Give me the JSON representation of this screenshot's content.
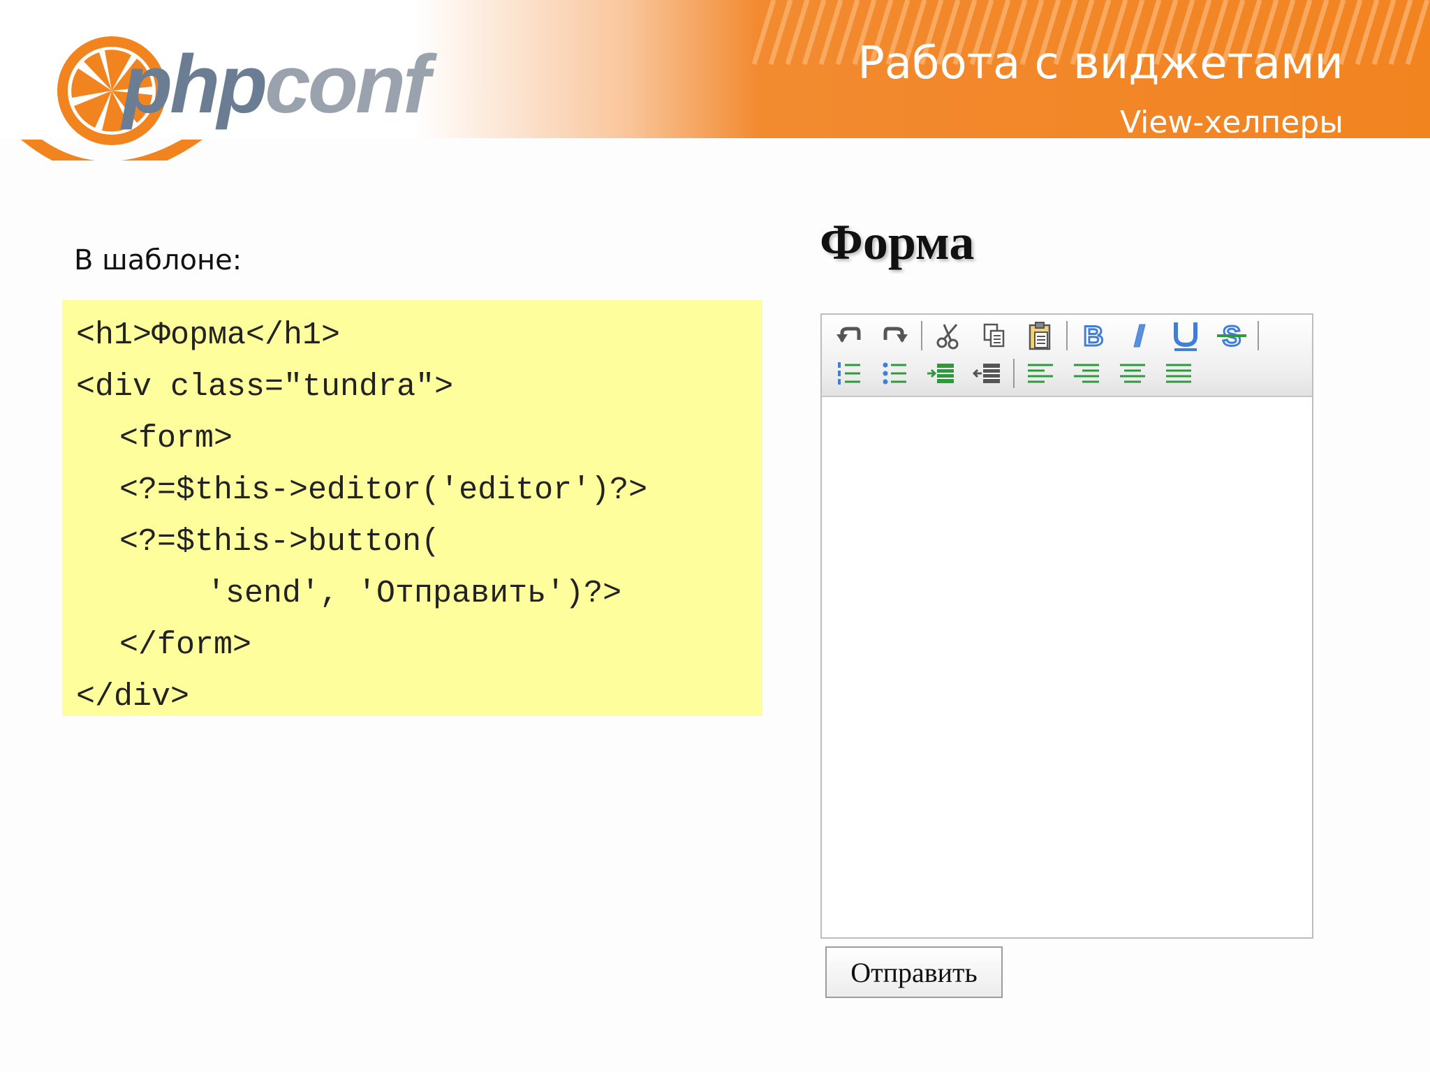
{
  "slide": {
    "title": "Работа с виджетами",
    "subtitle": "View-хелперы"
  },
  "logo": {
    "part1": "php",
    "part2": "conf"
  },
  "left": {
    "intro": "В шаблоне:",
    "code_lines": [
      "<h1>Форма</h1>",
      "<div class=\"tundra\">",
      "<form>",
      "<?=$this->editor('editor')?>",
      "<?=$this->button(",
      "'send', 'Отправить')?>",
      "</form>",
      "</div>"
    ]
  },
  "right": {
    "heading": "Форма",
    "submit_label": "Отправить",
    "toolbar": {
      "row1": [
        "undo-icon",
        "redo-icon",
        "|",
        "cut-icon",
        "copy-icon",
        "paste-icon",
        "|",
        "bold-icon",
        "italic-icon",
        "underline-icon",
        "strikethrough-icon",
        "|"
      ],
      "row2": [
        "ordered-list-icon",
        "unordered-list-icon",
        "indent-icon",
        "outdent-icon",
        "|",
        "align-left-icon",
        "align-right-icon",
        "align-center-icon",
        "justify-icon"
      ]
    }
  },
  "colors": {
    "accent": "#f28420",
    "code_background": "#fefe9d"
  }
}
